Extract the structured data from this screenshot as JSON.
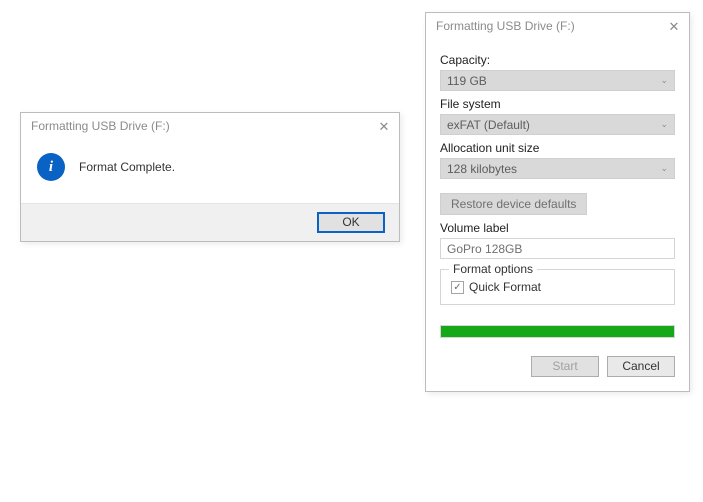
{
  "confirm_dialog": {
    "title": "Formatting USB Drive (F:)",
    "message": "Format Complete.",
    "ok_label": "OK"
  },
  "format_dialog": {
    "title": "Formatting USB Drive (F:)",
    "capacity_label": "Capacity:",
    "capacity_value": "119 GB",
    "filesystem_label": "File system",
    "filesystem_value": "exFAT (Default)",
    "allocation_label": "Allocation unit size",
    "allocation_value": "128 kilobytes",
    "restore_label": "Restore device defaults",
    "volume_label_label": "Volume label",
    "volume_label_value": "GoPro 128GB",
    "format_options_label": "Format options",
    "quick_format_label": "Quick Format",
    "quick_format_checked": true,
    "progress_percent": 100,
    "start_label": "Start",
    "cancel_label": "Cancel"
  },
  "colors": {
    "accent_blue": "#0a63c4",
    "progress_green": "#17a81a"
  },
  "icons": {
    "info": "i",
    "close": "✕",
    "chevron_down": "⌄",
    "check": "✓"
  }
}
